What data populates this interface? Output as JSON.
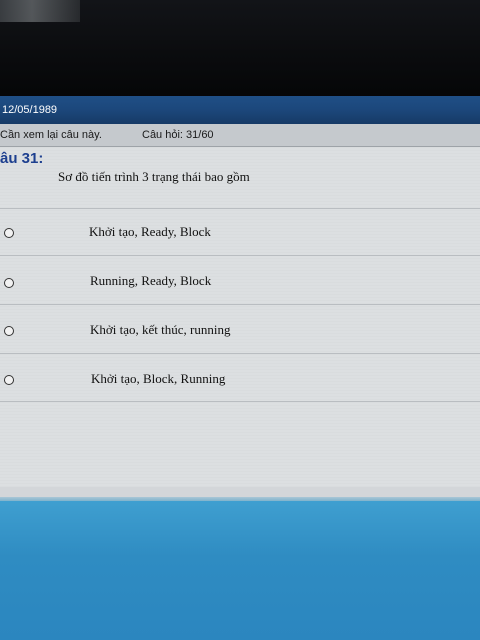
{
  "header": {
    "date": "12/05/1989"
  },
  "info_bar": {
    "review_text": "Cần xem lại câu này.",
    "question_count": "Câu hỏi: 31/60"
  },
  "question": {
    "number_label": "âu 31:",
    "text": "Sơ đồ tiến trình 3 trạng thái bao gồm",
    "options": [
      {
        "label": "Khởi tạo, Ready, Block"
      },
      {
        "label": "Running, Ready, Block"
      },
      {
        "label": "Khởi tạo, kết thúc, running"
      },
      {
        "label": "Khởi tạo, Block, Running"
      }
    ]
  }
}
